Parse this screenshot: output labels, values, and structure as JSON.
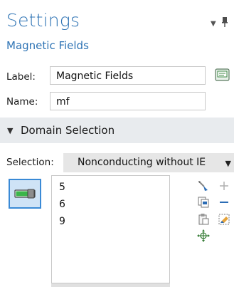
{
  "header": {
    "title": "Settings",
    "subtitle": "Magnetic Fields",
    "menu_icon": "dropdown-triangle-icon",
    "pin_icon": "pin-icon"
  },
  "fields": {
    "label_caption": "Label:",
    "label_value": "Magnetic Fields",
    "name_caption": "Name:",
    "name_value": "mf"
  },
  "section": {
    "title": "Domain Selection",
    "expanded": true
  },
  "selection": {
    "caption": "Selection:",
    "value": "Nonconducting without IE",
    "items": [
      "5",
      "6",
      "9"
    ]
  },
  "colors": {
    "accent": "#2f74b5",
    "section_bg": "#e8ebee",
    "active_toggle_bg": "#cfe3f6",
    "active_toggle_border": "#3a8ad6"
  }
}
